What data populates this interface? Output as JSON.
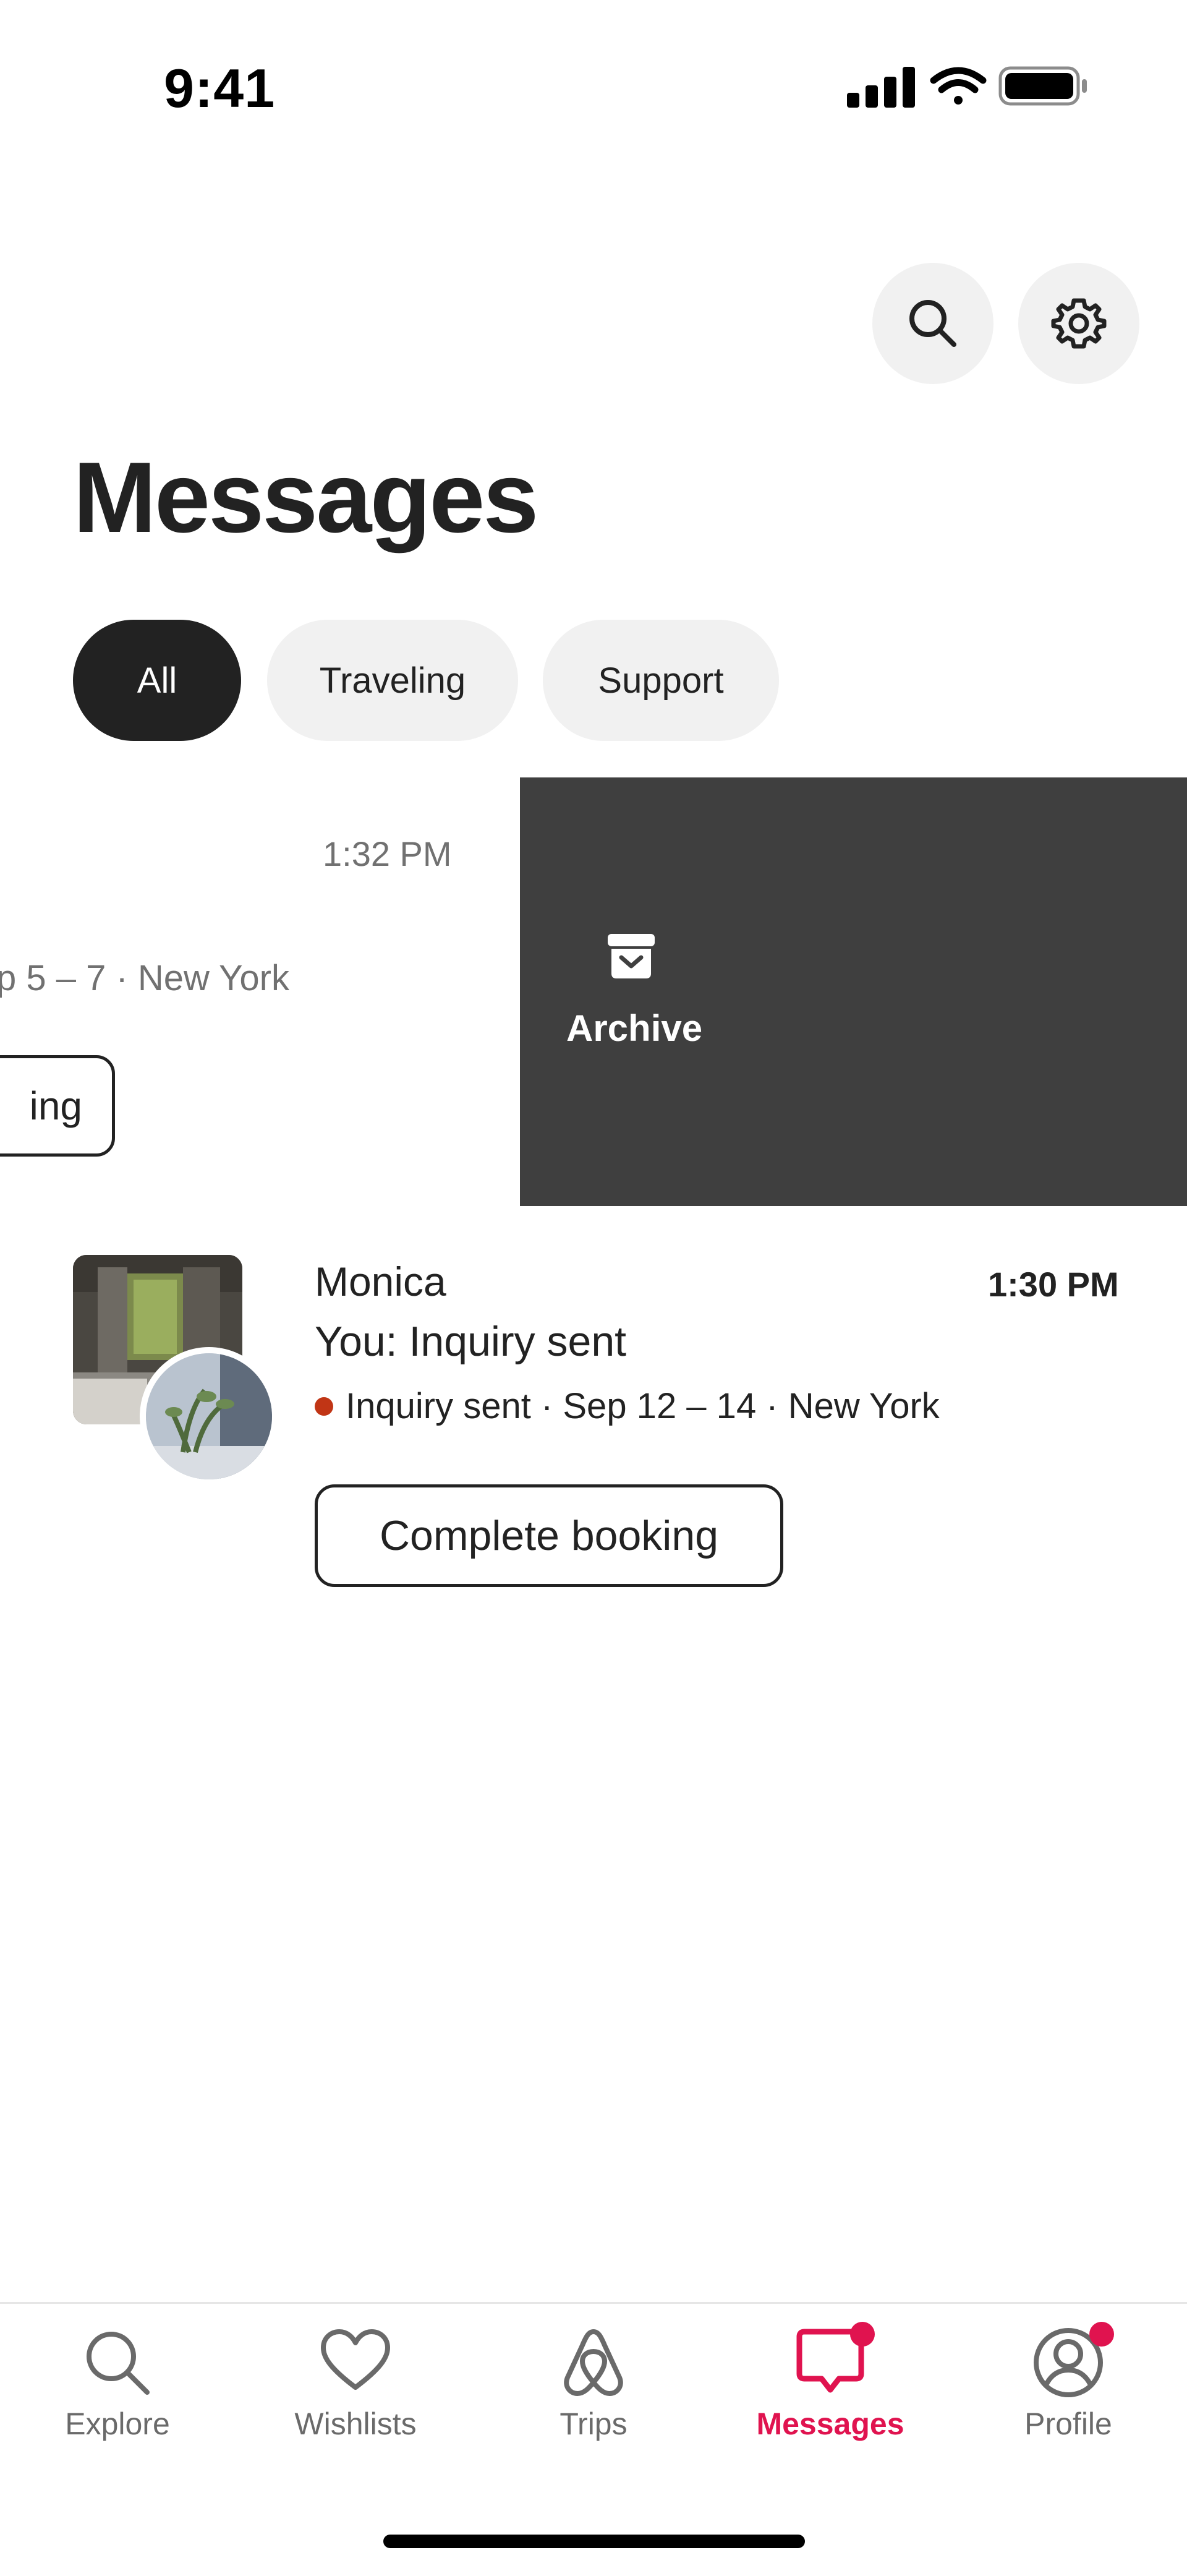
{
  "status_bar": {
    "time": "9:41"
  },
  "header": {
    "search_icon": "search-icon",
    "settings_icon": "gear-icon",
    "title": "Messages"
  },
  "filters": [
    {
      "label": "All",
      "active": true
    },
    {
      "label": "Traveling",
      "active": false
    },
    {
      "label": "Support",
      "active": false
    }
  ],
  "conversations": [
    {
      "time": "1:32 PM",
      "detail": "p 5 – 7 · New York",
      "action_label": "ing",
      "swipe_action": {
        "label": "Archive",
        "icon": "archive-icon"
      }
    },
    {
      "name": "Monica",
      "time": "1:30 PM",
      "preview": "You: Inquiry sent",
      "status": "Inquiry sent · Sep 12 – 14 · New York",
      "status_color": "#c13515",
      "action_label": "Complete booking"
    }
  ],
  "tabbar": {
    "items": [
      {
        "label": "Explore",
        "icon": "search-icon"
      },
      {
        "label": "Wishlists",
        "icon": "heart-icon"
      },
      {
        "label": "Trips",
        "icon": "airbnb-logo-icon"
      },
      {
        "label": "Messages",
        "icon": "message-icon",
        "active": true,
        "badge": true
      },
      {
        "label": "Profile",
        "icon": "profile-icon",
        "badge": true
      }
    ],
    "accent_color": "#e0134f"
  }
}
